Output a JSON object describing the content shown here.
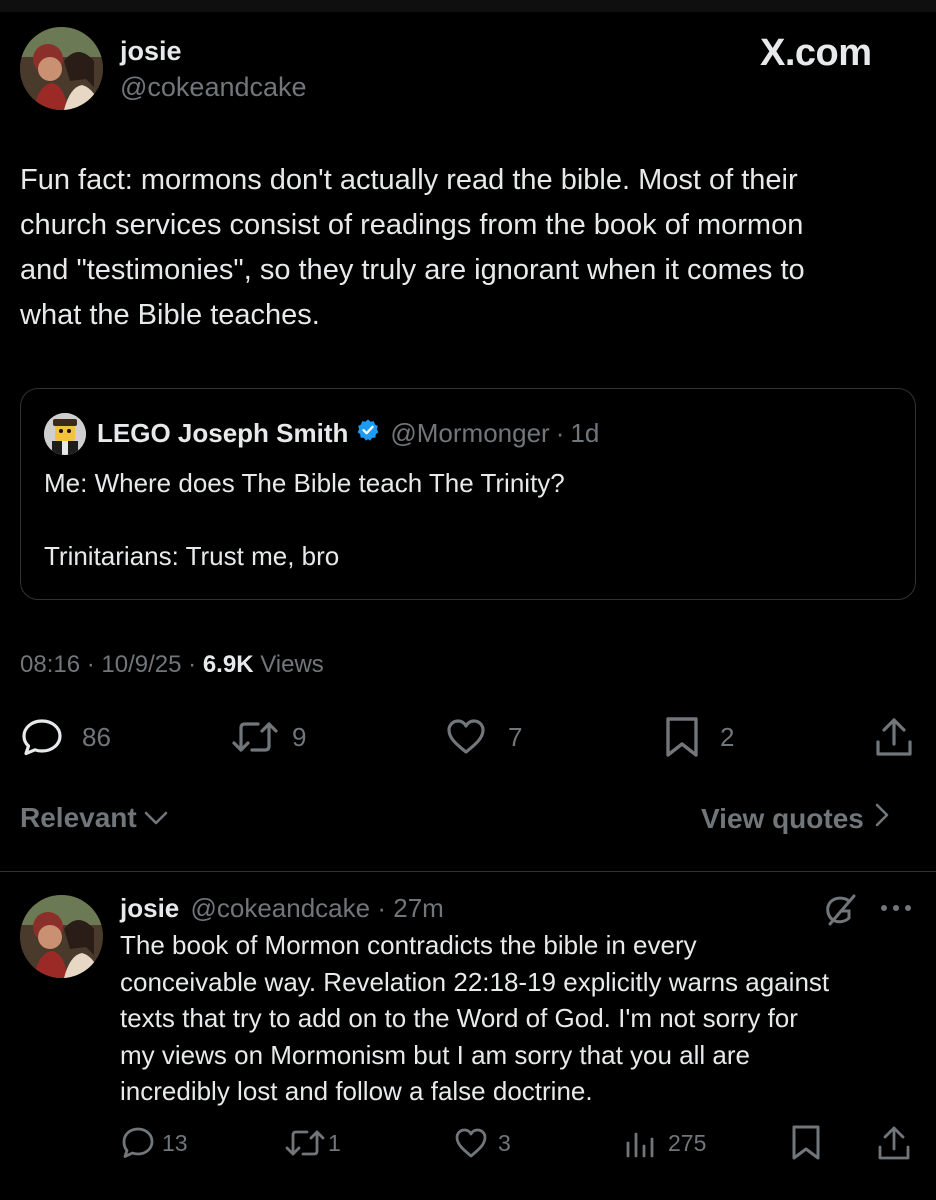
{
  "post": {
    "display_name": "josie",
    "handle": "@cokeandcake",
    "brand": "X.com",
    "text_lines": [
      "Fun fact: mormons don't actually read the bible. Most of their",
      "church services consist of readings from the book of mormon",
      "and \"testimonies\", so they truly are ignorant when it comes to",
      "what the Bible teaches."
    ],
    "quote": {
      "display_name": "LEGO Joseph Smith",
      "handle": "@Mormonger",
      "separator": "·",
      "time": "1d",
      "line1": "Me: Where does The Bible teach The Trinity?",
      "line2": "Trinitarians: Trust me, bro"
    },
    "meta": {
      "time": "08:16",
      "sep1": "·",
      "date": "10/9/25",
      "sep2": "·",
      "views_count": "6.9K",
      "views_label": "Views"
    },
    "actions": {
      "replies": "86",
      "reposts": "9",
      "likes": "7",
      "bookmarks": "2"
    }
  },
  "sort": {
    "relevant_label": "Relevant",
    "view_quotes_label": "View quotes"
  },
  "reply": {
    "display_name": "josie",
    "handle": "@cokeandcake",
    "separator": "·",
    "time": "27m",
    "text_lines": [
      "The book of Mormon contradicts the bible in every",
      "conceivable way. Revelation 22:18-19 explicitly warns against",
      "texts that try to add on to the Word of God. I'm not sorry for",
      "my views on Mormonism but I am sorry that you all are",
      "incredibly lost and follow a false doctrine."
    ],
    "actions": {
      "replies": "13",
      "reposts": "1",
      "likes": "3",
      "views": "275"
    }
  },
  "colors": {
    "background": "#000000",
    "text": "#e7e9ea",
    "muted": "#71767b",
    "border": "#2f3336",
    "verified": "#1d9bf0"
  }
}
